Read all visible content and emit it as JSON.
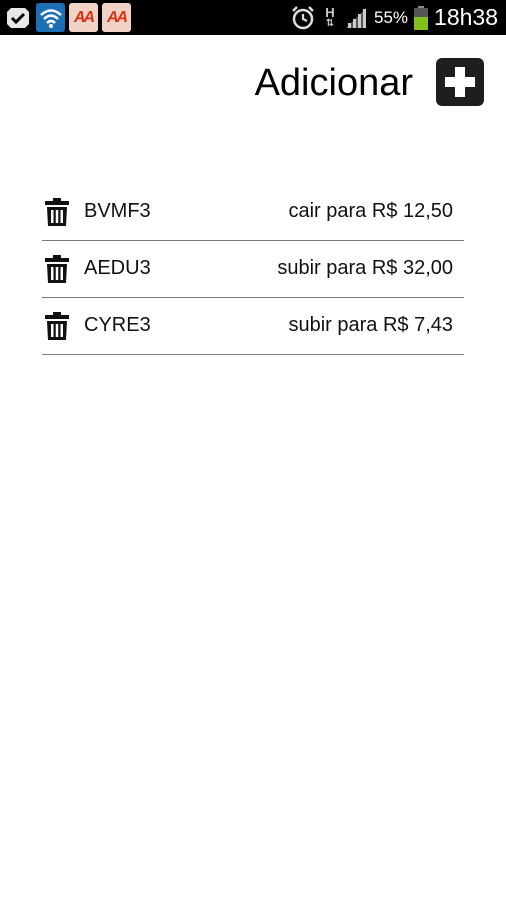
{
  "status_bar": {
    "icons": [
      "check-notification-icon",
      "wifi-icon",
      "aa-app-icon",
      "aa-app-icon",
      "alarm-icon",
      "network-h-icon",
      "signal-icon",
      "battery-icon"
    ],
    "aa_label": "AA",
    "network_label": "H",
    "battery_percent": "55%",
    "time": "18h38",
    "colors": {
      "bar": "#000000",
      "wifi_badge": "#1d6fb5",
      "aa_badge": "#f0d3c6",
      "aa_text": "#d53214",
      "battery": "#7fc21b"
    }
  },
  "header": {
    "title": "Adicionar",
    "add_icon": "plus-icon"
  },
  "alerts": [
    {
      "ticker": "BVMF3",
      "condition": "cair para R$ 12,50",
      "icon": "trash-icon"
    },
    {
      "ticker": "AEDU3",
      "condition": "subir para R$ 32,00",
      "icon": "trash-icon"
    },
    {
      "ticker": "CYRE3",
      "condition": "subir para R$ 7,43",
      "icon": "trash-icon"
    }
  ]
}
